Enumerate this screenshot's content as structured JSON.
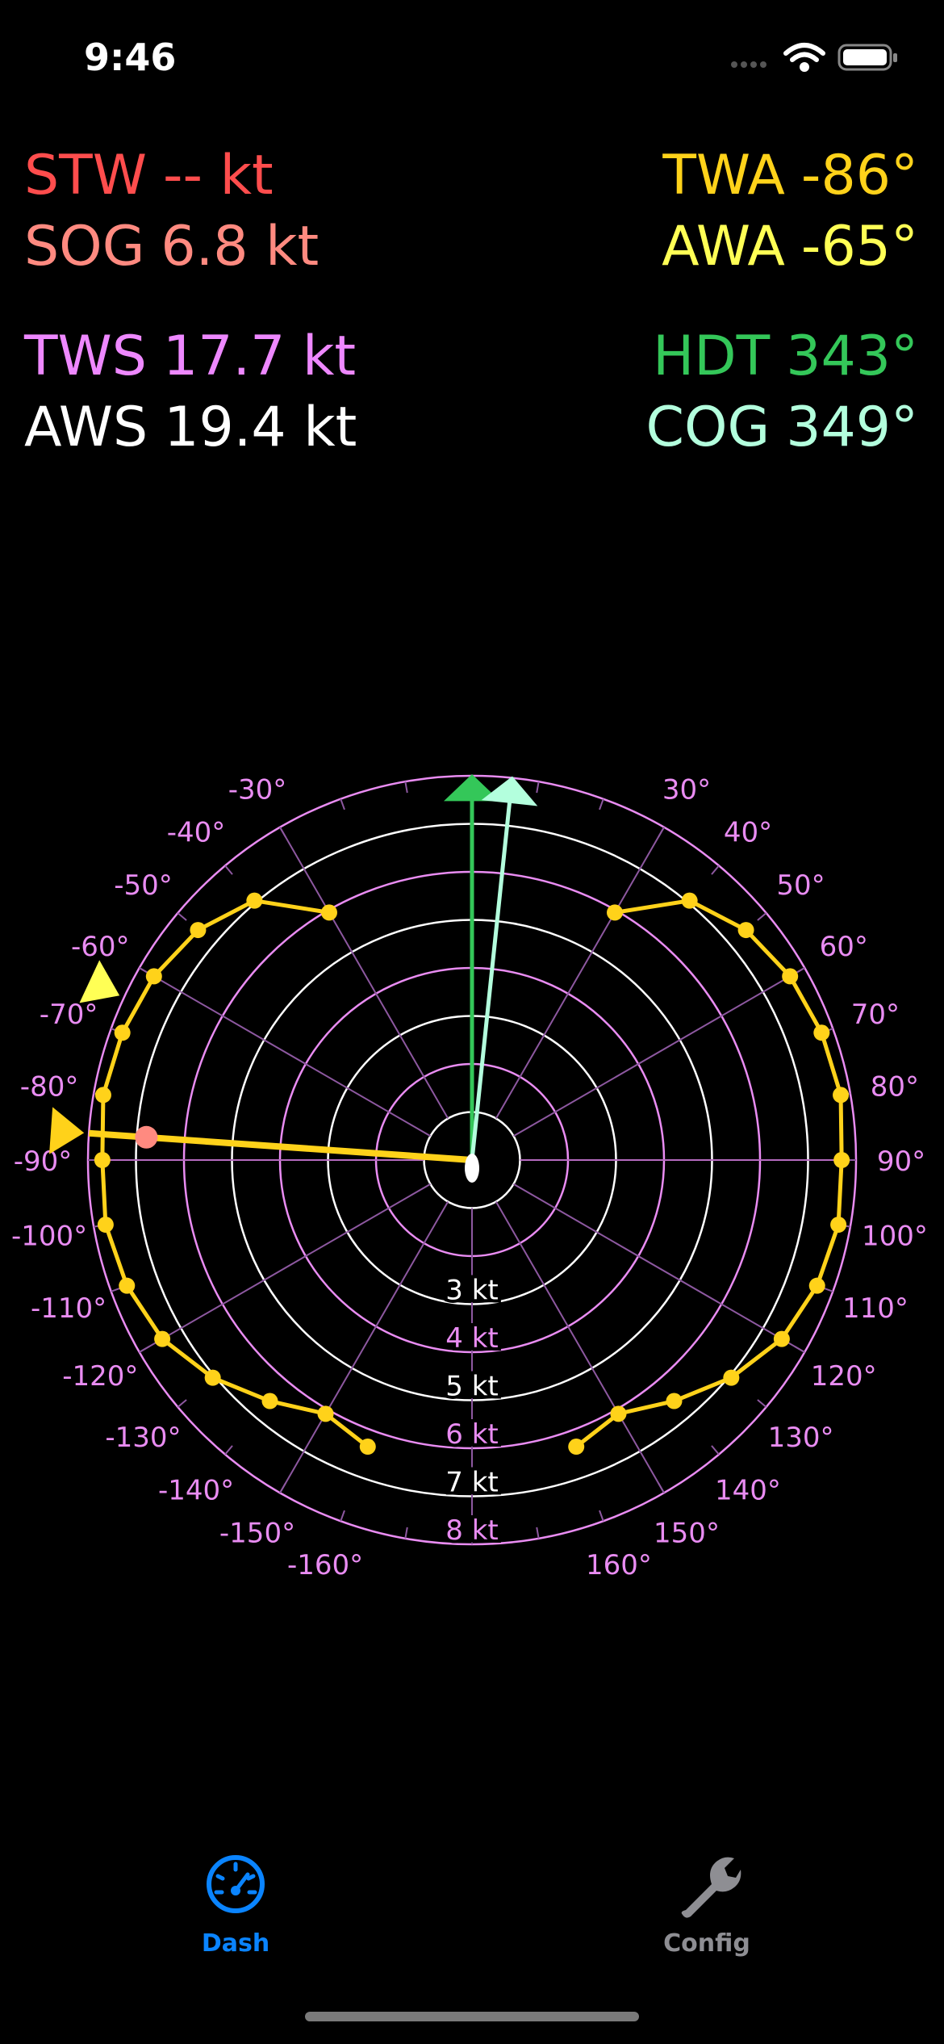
{
  "status_bar": {
    "time": "9:46",
    "icons": [
      "cellular-dots-icon",
      "wifi-icon",
      "battery-icon"
    ]
  },
  "metrics": {
    "stw": {
      "label": "STW",
      "value": "-- kt",
      "color": "#ff4d4d"
    },
    "sog": {
      "label": "SOG",
      "value": "6.8 kt",
      "color": "#ff8a80"
    },
    "tws": {
      "label": "TWS",
      "value": "17.7 kt",
      "color": "#ee88ff"
    },
    "aws": {
      "label": "AWS",
      "value": "19.4 kt",
      "color": "#ffffff"
    },
    "twa": {
      "label": "TWA",
      "value": "-86°",
      "color": "#ffd21a"
    },
    "awa": {
      "label": "AWA",
      "value": "-65°",
      "color": "#ffff55"
    },
    "hdt": {
      "label": "HDT",
      "value": "343°",
      "color": "#34c759"
    },
    "cog": {
      "label": "COG",
      "value": "349°",
      "color": "#b3ffdd"
    }
  },
  "polar": {
    "angle_labels_right": [
      "30°",
      "40°",
      "50°",
      "60°",
      "70°",
      "80°",
      "90°",
      "100°",
      "110°",
      "120°",
      "130°",
      "140°",
      "150°",
      "160°"
    ],
    "angle_labels_left": [
      "-30°",
      "-40°",
      "-50°",
      "-60°",
      "-70°",
      "-80°",
      "-90°",
      "-100°",
      "-110°",
      "-120°",
      "-130°",
      "-140°",
      "-150°",
      "-160°"
    ],
    "speed_rings": [
      "3 kt",
      "4 kt",
      "5 kt",
      "6 kt",
      "7 kt",
      "8 kt"
    ],
    "twa_deg": -86,
    "awa_deg": -65,
    "sog_kt": 6.8,
    "heading_deg": 343,
    "cog_deg": 349,
    "colors": {
      "ring_pink": "#e98cf2",
      "ring_white": "#ffffff",
      "polar": "#ffd21a",
      "heading": "#34c759",
      "cog": "#b3ffdd",
      "awa": "#ffff55",
      "sog_dot": "#ff8a80"
    },
    "polar_curve_twa": [
      30,
      40,
      50,
      60,
      70,
      80,
      90,
      100,
      110,
      120,
      130,
      140,
      150,
      160
    ],
    "polar_curve_kt": [
      5.95,
      7.05,
      7.45,
      7.65,
      7.75,
      7.8,
      7.7,
      7.75,
      7.65,
      7.45,
      7.05,
      6.55,
      6.1,
      6.35
    ]
  },
  "tabs": [
    {
      "label": "Dash",
      "icon": "speedometer-icon",
      "active": true,
      "color": "#0a84ff"
    },
    {
      "label": "Config",
      "icon": "wrench-icon",
      "active": false,
      "color": "#8e8e93"
    }
  ]
}
